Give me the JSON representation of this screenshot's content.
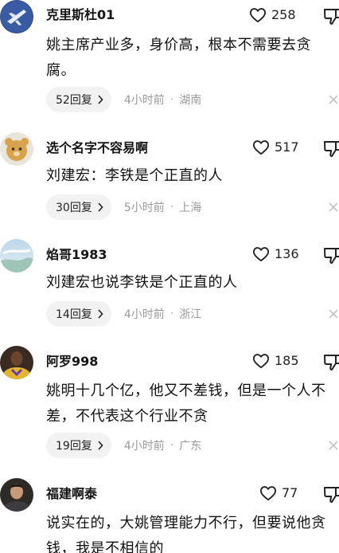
{
  "comments": [
    {
      "username": "克里斯杜01",
      "likes": "258",
      "text": "姚主席产业多，身价高，根本不需要去贪腐。",
      "replies": "52回复",
      "time": "4小时前",
      "location": "湖南"
    },
    {
      "username": "选个名字不容易啊",
      "likes": "517",
      "text": "刘建宏：李铁是个正直的人",
      "replies": "30回复",
      "time": "5小时前",
      "location": "上海"
    },
    {
      "username": "焰哥1983",
      "likes": "136",
      "text": "刘建宏也说李铁是个正直的人",
      "replies": "14回复",
      "time": "4小时前",
      "location": "浙江"
    },
    {
      "username": "阿罗998",
      "likes": "185",
      "text": "姚明十几个亿，他又不差钱，但是一个人不差，不代表这个行业不贪",
      "replies": "19回复",
      "time": "4小时前",
      "location": "广东"
    },
    {
      "username": "福建啊泰",
      "likes": "77",
      "text": "说实在的，大姚管理能力不行，但要说他贪钱，我是不相信的"
    }
  ],
  "meta_separator": "·",
  "icons": {
    "like": "heart-outline-icon",
    "dislike": "thumbs-down-icon",
    "reply_chevron": "chevron-right-icon",
    "close": "close-icon"
  },
  "colors": {
    "reply_pill_bg": "#f2f2f2",
    "meta_text": "#9a9a9a",
    "body_text": "#111111"
  }
}
